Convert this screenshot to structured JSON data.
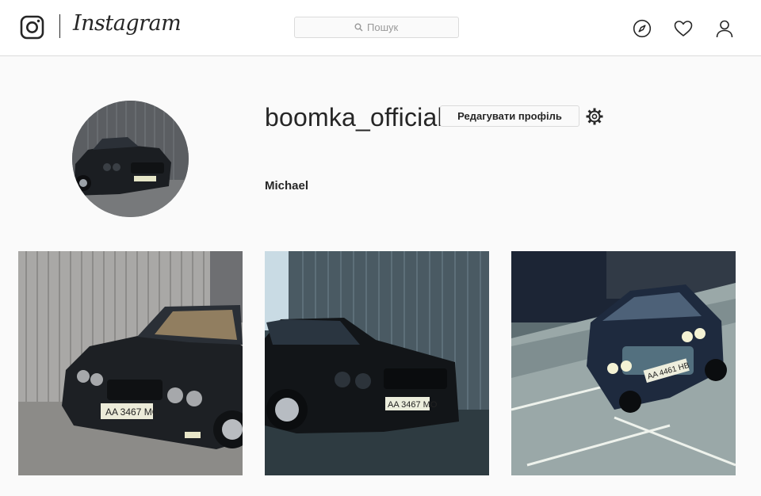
{
  "header": {
    "logo_icon": "instagram-camera-icon",
    "wordmark": "Instagram",
    "search": {
      "placeholder": "Пошук",
      "icon": "search-icon"
    },
    "nav_icons": [
      "compass-icon",
      "heart-icon",
      "user-icon"
    ]
  },
  "profile": {
    "username": "boomka_official",
    "edit_label": "Редагувати профіль",
    "settings_icon": "gear-icon",
    "full_name": "Michael",
    "avatar": "car-photo"
  },
  "posts": [
    {
      "plate": "AA 3467 MO",
      "scene": "dark sedan beside corrugated wall"
    },
    {
      "plate": "AA 3467 MO",
      "scene": "dark sedan near metal shed"
    },
    {
      "plate": "AA 4461 HB",
      "scene": "blue sedan at night parking lot"
    }
  ],
  "colors": {
    "text": "#262626",
    "border": "#dbdbdb",
    "background": "#fafafa",
    "header_bg": "#ffffff"
  }
}
